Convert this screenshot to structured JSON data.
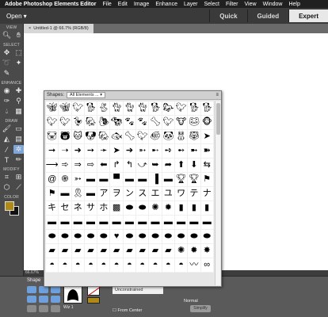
{
  "menubar": {
    "app": "Adobe Photoshop Elements Editor",
    "items": [
      "File",
      "Edit",
      "Image",
      "Enhance",
      "Layer",
      "Select",
      "Filter",
      "View",
      "Window",
      "Help"
    ]
  },
  "appbar": {
    "open_label": "Open",
    "modes": [
      "Quick",
      "Guided",
      "Expert"
    ],
    "active_mode": "Expert"
  },
  "toolbox": {
    "sections": {
      "view": "VIEW",
      "select": "SELECT",
      "enhance": "ENHANCE",
      "draw": "DRAW",
      "modify": "MODIFY",
      "color": "COLOR"
    }
  },
  "document": {
    "tab_label": "Untitled-1 @ 66.7% (RGB/8)",
    "zoom": "66.67%"
  },
  "shapes_panel": {
    "label": "Shapes:",
    "selection": "All Elements ..."
  },
  "options": {
    "tool_label": "Shape",
    "selected_shape_name": "Wiz 1",
    "constraint": "Unconstrained",
    "from_center": "From Center",
    "blend_mode": "Normal",
    "simplify_label": "Simplify"
  },
  "colors": {
    "foreground": "#b08a14",
    "background": "#111111",
    "accent": "#7ea6d8"
  }
}
